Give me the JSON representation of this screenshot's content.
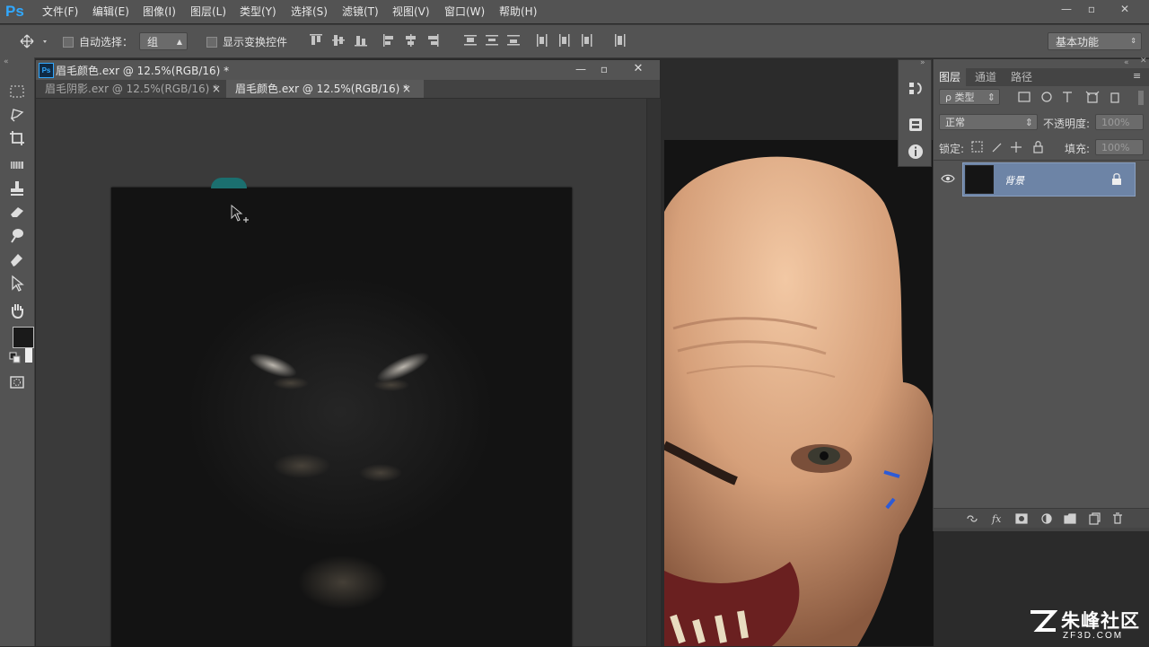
{
  "app": {
    "logo": "Ps"
  },
  "menu": {
    "items": [
      "文件(F)",
      "编辑(E)",
      "图像(I)",
      "图层(L)",
      "类型(Y)",
      "选择(S)",
      "滤镜(T)",
      "视图(V)",
      "窗口(W)",
      "帮助(H)"
    ]
  },
  "window_controls": {
    "minimize": "—",
    "restore": "▫",
    "close": "✕"
  },
  "options": {
    "auto_select_label": "自动选择：",
    "auto_select_value": "组",
    "show_transform_label": "显示变换控件",
    "workspace": "基本功能"
  },
  "document": {
    "title": "眉毛颜色.exr @ 12.5%(RGB/16) *",
    "tabs": [
      {
        "label": "眉毛阴影.exr @ 12.5%(RGB/16) *",
        "close": "×"
      },
      {
        "label": "眉毛颜色.exr @ 12.5%(RGB/16) *",
        "close": "×"
      }
    ]
  },
  "layers_panel": {
    "tabs": [
      "图层",
      "通道",
      "路径"
    ],
    "filter_label": "ρ 类型",
    "blend_mode": "正常",
    "opacity_label": "不透明度:",
    "opacity_value": "100%",
    "lock_label": "锁定:",
    "fill_label": "填充:",
    "fill_value": "100%",
    "layer_name": "背景"
  },
  "watermark": {
    "brand": "朱峰社区",
    "domain": "ZF3D.COM"
  },
  "colors": {
    "accent": "#31a8ff",
    "selected_layer": "#6d84a6",
    "ui_bg": "#535353"
  },
  "icons": {
    "tools": [
      "marquee-icon",
      "lasso-icon",
      "crop-icon",
      "patch-icon",
      "stamp-icon",
      "eraser-icon",
      "smudge-icon",
      "pen-icon",
      "path-select-icon",
      "hand-icon"
    ],
    "dock": [
      "history-icon",
      "properties-icon",
      "info-icon"
    ]
  }
}
